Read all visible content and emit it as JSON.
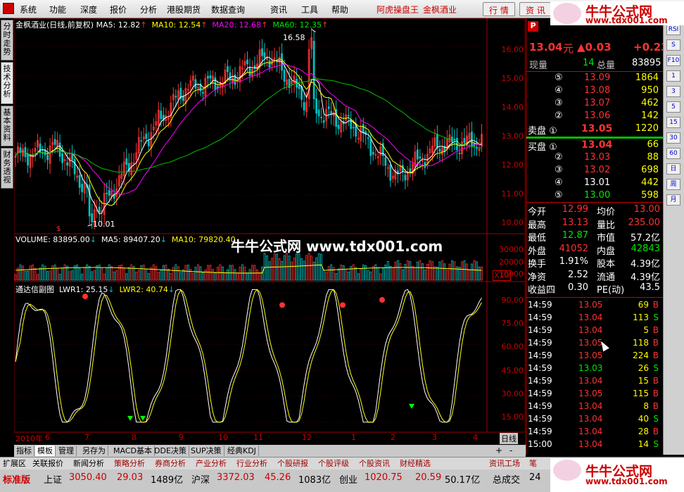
{
  "menu": {
    "items": [
      "系统",
      "功能",
      "深度",
      "报价",
      "分析",
      "港股期货",
      "数据查询",
      "资讯",
      "工具",
      "帮助"
    ],
    "title_app": "阿虎操盘王",
    "title_stock": "金枫酒业",
    "btn_quote": "行 情",
    "btn_info": "资 讯"
  },
  "left_tabs": [
    "分时走势",
    "技术分析",
    "基本资料",
    "财务透视"
  ],
  "price_pane": {
    "title": "金枫酒业(日线,前复权)",
    "ma5": "MA5: 12.82",
    "ma10": "MA10: 12.54",
    "ma20": "MA20: 12.68",
    "ma60": "MA60: 12.35",
    "scale": [
      "16.00",
      "15.00",
      "14.00",
      "13.00",
      "12.00",
      "11.00",
      "10.00"
    ],
    "high_label": "16.58",
    "low_label": "10.01"
  },
  "vol_pane": {
    "title": "VOLUME: 83895.00",
    "ma5": "MA5: 89407.20",
    "ma10": "MA10: 79820.40",
    "scale": [
      "30000",
      "20000",
      "10000"
    ],
    "unit": "X10"
  },
  "ind_pane": {
    "title": "通达信副图",
    "lwr1": "LWR1: 25.15",
    "lwr2": "LWR2: 40.74",
    "scale": [
      "90.00",
      "75.00",
      "60.00",
      "45.00",
      "30.00",
      "15.00"
    ]
  },
  "xaxis": {
    "labels": [
      "2010年",
      "6",
      "7",
      "8",
      "9",
      "10",
      "11",
      "12",
      "1",
      "2",
      "3",
      "4"
    ],
    "period": "日线"
  },
  "watermark": "牛牛公式网 www.tdx001.com",
  "chart_data": {
    "type": "line",
    "price": {
      "x": [
        "2010-05",
        "2010-06",
        "2010-07",
        "2010-08",
        "2010-09",
        "2010-10",
        "2010-11",
        "2010-12",
        "2011-01",
        "2011-02",
        "2011-03",
        "2011-04"
      ],
      "close": [
        12.3,
        12.6,
        10.5,
        12.8,
        14.6,
        14.9,
        15.7,
        13.9,
        13.3,
        11.6,
        12.7,
        12.8
      ],
      "ma5_last": 12.82,
      "ma10_last": 12.54,
      "ma20_last": 12.68,
      "ma60_last": 12.35,
      "ylim": [
        9.8,
        16.9
      ]
    },
    "lwr": {
      "lwr1_last": 25.15,
      "lwr2_last": 40.74,
      "ylim": [
        10,
        95
      ]
    }
  },
  "quote": {
    "code_badge": "P",
    "price": "13.04",
    "unit": "元",
    "change": "▲0.03",
    "change_pct": "+0.23",
    "now_vol_label": "现量",
    "now_vol": "14",
    "total_vol_label": "总量",
    "total_vol": "83895",
    "asks": [
      {
        "lv": "⑤",
        "p": "13.09",
        "v": "1864"
      },
      {
        "lv": "④",
        "p": "13.08",
        "v": "950"
      },
      {
        "lv": "③",
        "p": "13.07",
        "v": "462"
      },
      {
        "lv": "②",
        "p": "13.06",
        "v": "142"
      },
      {
        "lv": "卖盘 ①",
        "p": "13.05",
        "v": "1220"
      }
    ],
    "bids": [
      {
        "lv": "买盘 ①",
        "p": "13.04",
        "v": "66"
      },
      {
        "lv": "②",
        "p": "13.03",
        "v": "88"
      },
      {
        "lv": "③",
        "p": "13.02",
        "v": "698"
      },
      {
        "lv": "④",
        "p": "13.01",
        "v": "442"
      },
      {
        "lv": "⑤",
        "p": "13.00",
        "v": "598"
      }
    ],
    "stats": [
      {
        "k1": "今开",
        "v1": "12.99",
        "k2": "均价",
        "v2": "13.00"
      },
      {
        "k1": "最高",
        "v1": "13.13",
        "k2": "量比",
        "v2": "235.00"
      },
      {
        "k1": "最低",
        "v1": "12.87",
        "k2": "市值",
        "v2": "57.2亿"
      },
      {
        "k1": "外盘",
        "v1": "41052",
        "k2": "内盘",
        "v2": "42843"
      },
      {
        "k1": "换手",
        "v1": "1.91%",
        "k2": "股本",
        "v2": "4.39亿"
      },
      {
        "k1": "净资",
        "v1": "2.52",
        "k2": "流通",
        "v2": "4.39亿"
      },
      {
        "k1": "收益四",
        "v1": "0.30",
        "k2": "PE(动)",
        "v2": "43.5"
      }
    ],
    "ticks": [
      {
        "t": "14:59",
        "p": "13.05",
        "v": "69",
        "bs": "B"
      },
      {
        "t": "14:59",
        "p": "13.04",
        "v": "113",
        "bs": "S"
      },
      {
        "t": "14:59",
        "p": "13.04",
        "v": "5",
        "bs": "B"
      },
      {
        "t": "14:59",
        "p": "13.05",
        "v": "118",
        "bs": "B"
      },
      {
        "t": "14:59",
        "p": "13.05",
        "v": "224",
        "bs": "B"
      },
      {
        "t": "14:59",
        "p": "13.03",
        "v": "26",
        "bs": "S"
      },
      {
        "t": "14:59",
        "p": "13.04",
        "v": "15",
        "bs": "B"
      },
      {
        "t": "14:59",
        "p": "13.05",
        "v": "115",
        "bs": "B"
      },
      {
        "t": "14:59",
        "p": "13.04",
        "v": "8",
        "bs": "B"
      },
      {
        "t": "14:59",
        "p": "13.04",
        "v": "40",
        "bs": "S"
      },
      {
        "t": "14:59",
        "p": "13.04",
        "v": "28",
        "bs": "B"
      },
      {
        "t": "15:00",
        "p": "13.04",
        "v": "14",
        "bs": "S"
      }
    ]
  },
  "right_icons": [
    "RSI",
    "S",
    "F10",
    "1",
    "3",
    "5",
    "15",
    "30",
    "60",
    "日",
    "周",
    "月"
  ],
  "bottom_tabs": [
    "指标",
    "模板",
    "管理",
    "另存为",
    "MACD基本",
    "DDE决策",
    "SUP决策",
    "经典KDJ"
  ],
  "zoom": {
    "plus": "+",
    "minus": "-"
  },
  "func_bar": [
    "扩展区",
    "关联报价",
    "新闻分析",
    "策略分析",
    "券商分析",
    "产业分析",
    "行业分析",
    "个股研报",
    "个股评级",
    "个股资讯",
    "财经精选",
    "资讯工场",
    "笔"
  ],
  "status": {
    "edition": "标准版",
    "sh_label": "上证",
    "sh_idx": "3050.40",
    "sh_chg": "29.03",
    "sh_amt": "1489亿",
    "sz_label": "沪深",
    "sz_idx": "3372.03",
    "sz_chg": "45.26",
    "sz_amt": "1083亿",
    "cy_label": "创业",
    "cy_idx": "1020.75",
    "cy_chg": "20.59",
    "cy_amt": "50.17亿",
    "total_label": "总成交",
    "total_num": "24"
  },
  "logo": {
    "t1": "牛牛公式网",
    "t2": "www.tdx001.com"
  }
}
